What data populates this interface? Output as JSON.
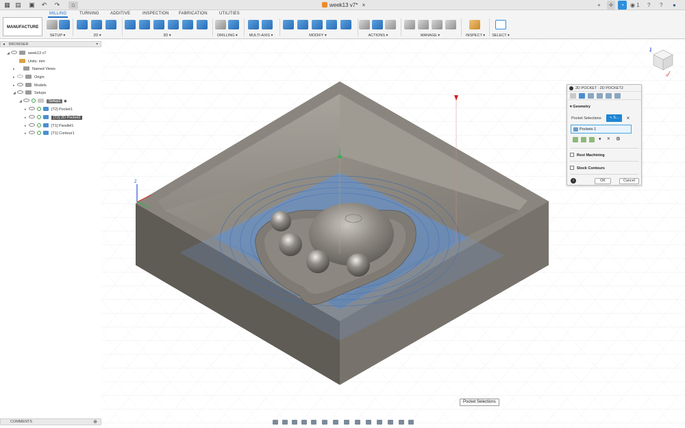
{
  "titlebar": {
    "document_title": "week13 v7*",
    "notifications_count": "1"
  },
  "ribbon": {
    "workspace_label": "MANUFACTURE",
    "tabs": [
      {
        "label": "MILLING",
        "active": true
      },
      {
        "label": "TURNING",
        "active": false
      },
      {
        "label": "ADDITIVE",
        "active": false
      },
      {
        "label": "INSPECTION",
        "active": false
      },
      {
        "label": "FABRICATION",
        "active": false
      },
      {
        "label": "UTILITIES",
        "active": false
      }
    ],
    "groups": [
      {
        "label": "SETUP"
      },
      {
        "label": "2D"
      },
      {
        "label": "3D"
      },
      {
        "label": "DRILLING"
      },
      {
        "label": "MULTI-AXIS"
      },
      {
        "label": "MODIFY"
      },
      {
        "label": "ACTIONS"
      },
      {
        "label": "MANAGE"
      },
      {
        "label": "INSPECT"
      },
      {
        "label": "SELECT"
      }
    ]
  },
  "browser": {
    "header": "BROWSER",
    "items": [
      {
        "label": "week13 v7"
      },
      {
        "label": "Units: mm"
      },
      {
        "label": "Named Views"
      },
      {
        "label": "Origin"
      },
      {
        "label": "Models"
      },
      {
        "label": "Setups"
      },
      {
        "label": "Setup1"
      },
      {
        "label": "[T2] Pocket1"
      },
      {
        "label": "[T2] 2D Pocket2"
      },
      {
        "label": "[T1] Parallel1"
      },
      {
        "label": "[T1] Contour1"
      }
    ]
  },
  "comments": {
    "header": "COMMENTS"
  },
  "dialog": {
    "title": "2D POCKET : 2D POCKET2",
    "geometry_section": "Geometry",
    "pocket_selections_label": "Pocket Selections",
    "select_button": "S...",
    "pocket_list_item": "Pockets 1",
    "rest_machining_label": "Rest Machining",
    "stock_contours_label": "Stock Contours",
    "ok_label": "OK",
    "cancel_label": "Cancel"
  },
  "tooltip": {
    "text": "Pocket Selections"
  },
  "viewport": {
    "axis_z": "Z",
    "axis_x": "X",
    "viewcube_z": "Z",
    "viewcube_x": "X"
  },
  "colors": {
    "accent": "#1f86d3",
    "stock": "#6e6a63",
    "toolpath": "#3f79c9",
    "tab_active": "#1f6fc4"
  }
}
